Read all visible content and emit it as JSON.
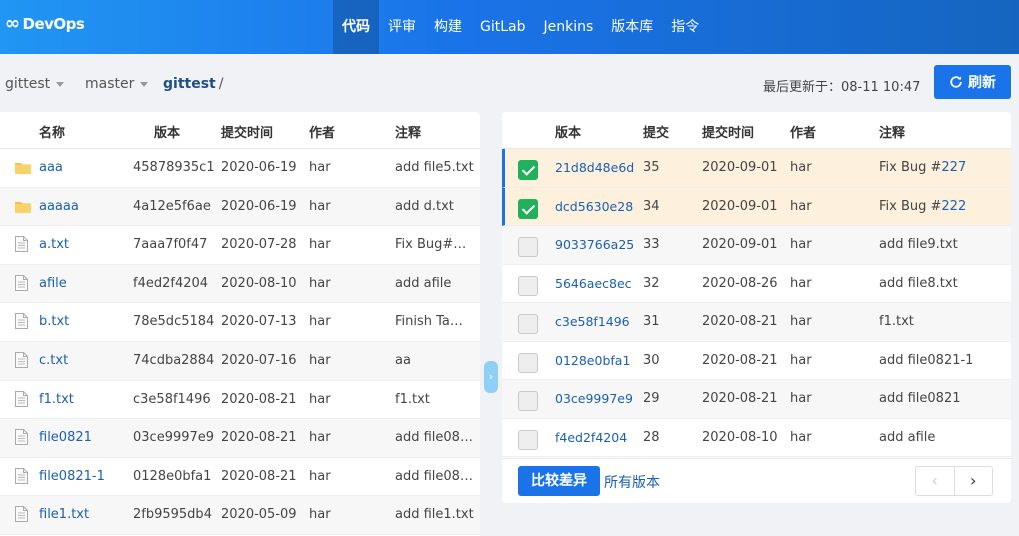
{
  "app": {
    "logo_text": "DevOps"
  },
  "nav": [
    {
      "label": "代码",
      "active": true
    },
    {
      "label": "评审"
    },
    {
      "label": "构建"
    },
    {
      "label": "GitLab"
    },
    {
      "label": "Jenkins"
    },
    {
      "label": "版本库"
    },
    {
      "label": "指令"
    }
  ],
  "toolbar": {
    "repo_select": "gittest",
    "branch_select": "master",
    "path": "gittest",
    "path_sep": "/",
    "updated_label": "最后更新于：08-11 10:47",
    "refresh_label": "刷新"
  },
  "files": {
    "headers": {
      "name": "名称",
      "version": "版本",
      "time": "提交时间",
      "author": "作者",
      "note": "注释"
    },
    "rows": [
      {
        "type": "folder",
        "name": "aaa",
        "version": "45878935c1",
        "time": "2020-06-19",
        "author": "har",
        "note": "add file5.txt"
      },
      {
        "type": "folder",
        "name": "aaaaa",
        "version": "4a12e5f6ae",
        "time": "2020-06-19",
        "author": "har",
        "note": "add d.txt"
      },
      {
        "type": "file",
        "name": "a.txt",
        "version": "7aaa7f0f47",
        "time": "2020-07-28",
        "author": "har",
        "note": "Fix Bug#…"
      },
      {
        "type": "file",
        "name": "afile",
        "version": "f4ed2f4204",
        "time": "2020-08-10",
        "author": "har",
        "note": "add afile"
      },
      {
        "type": "file",
        "name": "b.txt",
        "version": "78e5dc5184",
        "time": "2020-07-13",
        "author": "har",
        "note": "Finish Ta…"
      },
      {
        "type": "file",
        "name": "c.txt",
        "version": "74cdba2884",
        "time": "2020-07-16",
        "author": "har",
        "note": "aa"
      },
      {
        "type": "file",
        "name": "f1.txt",
        "version": "c3e58f1496",
        "time": "2020-08-21",
        "author": "har",
        "note": "f1.txt"
      },
      {
        "type": "file",
        "name": "file0821",
        "version": "03ce9997e9",
        "time": "2020-08-21",
        "author": "har",
        "note": "add file08…"
      },
      {
        "type": "file",
        "name": "file0821-1",
        "version": "0128e0bfa1",
        "time": "2020-08-21",
        "author": "har",
        "note": "add file08…"
      },
      {
        "type": "file",
        "name": "file1.txt",
        "version": "2fb9595db4",
        "time": "2020-05-09",
        "author": "har",
        "note": "add file1.txt"
      }
    ]
  },
  "commits": {
    "headers": {
      "version": "版本",
      "count": "提交",
      "time": "提交时间",
      "author": "作者",
      "note": "注释"
    },
    "rows": [
      {
        "checked": true,
        "version": "21d8d48e6d",
        "count": "35",
        "time": "2020-09-01",
        "author": "har",
        "note_text": "Fix Bug #",
        "note_link": "227"
      },
      {
        "checked": true,
        "version": "dcd5630e28",
        "count": "34",
        "time": "2020-09-01",
        "author": "har",
        "note_text": "Fix Bug #",
        "note_link": "222"
      },
      {
        "checked": false,
        "version": "9033766a25",
        "count": "33",
        "time": "2020-09-01",
        "author": "har",
        "note_text": "add file9.txt",
        "note_link": ""
      },
      {
        "checked": false,
        "version": "5646aec8ec",
        "count": "32",
        "time": "2020-08-26",
        "author": "har",
        "note_text": "add file8.txt",
        "note_link": ""
      },
      {
        "checked": false,
        "version": "c3e58f1496",
        "count": "31",
        "time": "2020-08-21",
        "author": "har",
        "note_text": "f1.txt",
        "note_link": ""
      },
      {
        "checked": false,
        "version": "0128e0bfa1",
        "count": "30",
        "time": "2020-08-21",
        "author": "har",
        "note_text": "add file0821-1",
        "note_link": ""
      },
      {
        "checked": false,
        "version": "03ce9997e9",
        "count": "29",
        "time": "2020-08-21",
        "author": "har",
        "note_text": "add file0821",
        "note_link": ""
      },
      {
        "checked": false,
        "version": "f4ed2f4204",
        "count": "28",
        "time": "2020-08-10",
        "author": "har",
        "note_text": "add afile",
        "note_link": ""
      }
    ],
    "compare_label": "比较差异",
    "all_versions_label": "所有版本",
    "prev_icon": "‹",
    "next_icon": "›"
  },
  "icons": {
    "refresh": "refresh-icon",
    "folder": "folder-icon",
    "file": "file-icon",
    "collapse": "chevron-right-icon"
  },
  "colors": {
    "primary": "#1a73e8",
    "selected_row": "#fdf0dc",
    "check_green": "#21b05b",
    "link": "#1a5fb4"
  }
}
